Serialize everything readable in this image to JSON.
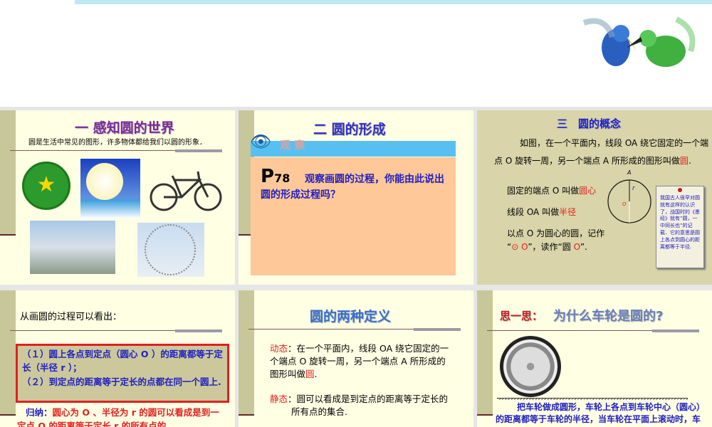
{
  "slides": [
    {
      "title": "一 感知圆的世界",
      "subtitle": "圆是生活中常见的图形，许多物体都给我们以圆的形象．"
    },
    {
      "title": "二 圆的形成",
      "observe": "观 察",
      "page": "P",
      "page_num": "78",
      "question": "观察画圆的过程，你能由此说出圆的形成过程吗？"
    },
    {
      "title": "三　圆的概念",
      "intro": "如图，在一个平面内，线段 OA 绕它固定的一个端点 O 旋转一周，另一个端点 A 所形成的图形叫做",
      "intro_hl": "圆",
      "intro_end": ".",
      "l1": "固定的端点 O 叫做",
      "l1_hl": "圆心",
      "l2": "线段 OA 叫做",
      "l2_hl": "半径",
      "l3": "以点 O 为圆心的圆，记作",
      "l4a": "“",
      "l4_sym": "⊙ O",
      "l4b": "”，读作“圆 ",
      "l4_o": "O",
      "l4c": "”.",
      "label_a": "A",
      "label_r": "r",
      "label_o": "O",
      "note": "我国古人很早对圆就有这样的认识了，战国时的《墨经》就有“圆，一中同长也”的记载．它的意思是圆上各点到圆心的距离都等于半径."
    },
    {
      "heading": "从画圆的过程可以看出：",
      "p1": "（１）圆上各点到定点（圆心 O ）的距离都等于定长（半径 r ）；",
      "p2": "（２）到定点的距离等于定长的点都在同一个圆上.",
      "sum_label": "归纳：",
      "sum": "圆心为 O 、半径为 r 的圆可以看成是到一定点 O 的距离等于定长 r 的所有点的"
    },
    {
      "title": "圆的两种定义",
      "dyn_label": "动态",
      "dyn": "：在一个平面内，线段 OA 绕它固定的一个端点 O 旋转一周，另一个端点 A 所形成的图形叫做",
      "dyn_hl": "圆",
      "dyn_end": ".",
      "sta_label": "静态",
      "sta": "：圆可以看成是到定点的距离等于定长的所有点的集合."
    },
    {
      "think": "思一思：",
      "title": "为什么车轮是圆的?",
      "text": "把车轮做成圆形，车轮上各点到车轮中心（圆心）的距离都等于车轮的半径，当车轮在平面上滚动时，车轴中心与平面的距离保持不变，因此，当"
    }
  ]
}
